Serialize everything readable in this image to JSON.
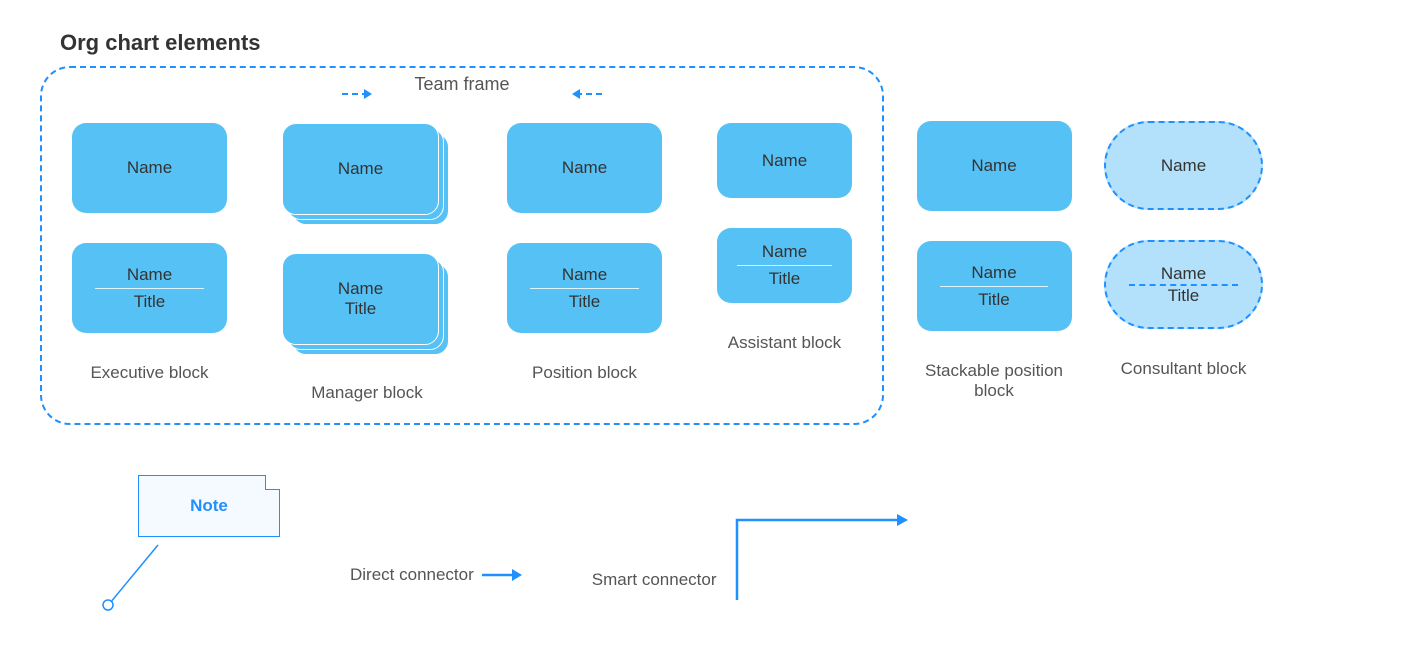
{
  "pageTitle": "Org chart elements",
  "frameLabel": "Team frame",
  "labels": {
    "name": "Name",
    "title": "Title"
  },
  "captions": {
    "executive": "Executive block",
    "manager": "Manager block",
    "position": "Position block",
    "assistant": "Assistant block",
    "stackable": "Stackable position block",
    "consultant": "Consultant block"
  },
  "note": {
    "text": "Note"
  },
  "connectors": {
    "direct": "Direct connector",
    "smart": "Smart connector"
  }
}
